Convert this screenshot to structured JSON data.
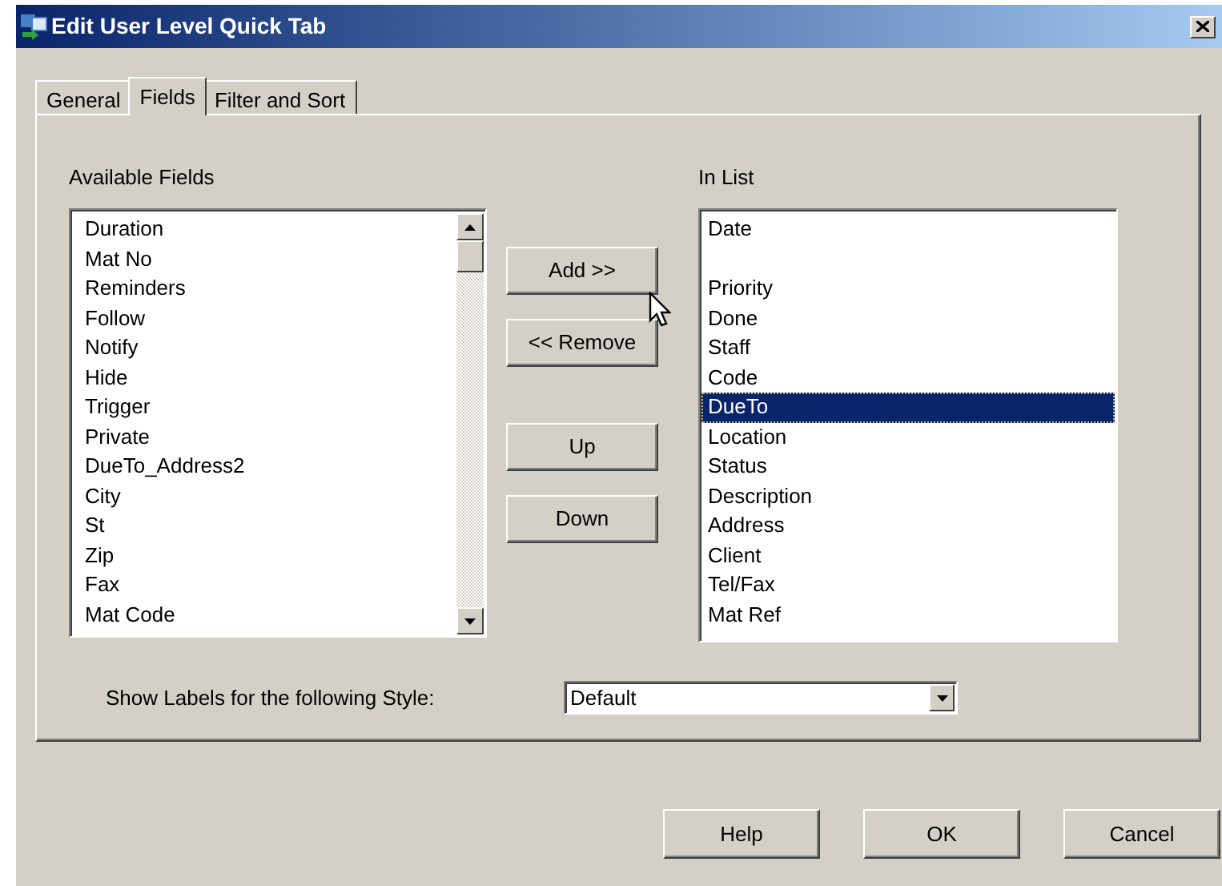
{
  "window": {
    "title": "Edit User Level Quick Tab"
  },
  "tabs": [
    {
      "label": "General",
      "selected": false
    },
    {
      "label": "Fields",
      "selected": true
    },
    {
      "label": "Filter and Sort",
      "selected": false
    }
  ],
  "available_fields": {
    "label": "Available Fields",
    "items": [
      {
        "label": "Duration",
        "selected": false
      },
      {
        "label": "Mat No",
        "selected": false
      },
      {
        "label": "Reminders",
        "selected": false
      },
      {
        "label": "Follow",
        "selected": false
      },
      {
        "label": "Notify",
        "selected": false
      },
      {
        "label": "Hide",
        "selected": false
      },
      {
        "label": "Trigger",
        "selected": false
      },
      {
        "label": "Private",
        "selected": false
      },
      {
        "label": "DueTo_Address2",
        "selected": false
      },
      {
        "label": "City",
        "selected": false
      },
      {
        "label": "St",
        "selected": false
      },
      {
        "label": "Zip",
        "selected": false
      },
      {
        "label": "Fax",
        "selected": false
      },
      {
        "label": "Mat Code",
        "selected": false
      }
    ]
  },
  "move_buttons": [
    "Add >>",
    "<< Remove",
    "Up",
    "Down"
  ],
  "in_list": {
    "label": "In List",
    "items": [
      {
        "kind": "field",
        "label": "Date",
        "selected": false
      },
      {
        "kind": "blank"
      },
      {
        "kind": "field",
        "label": "Priority",
        "selected": false
      },
      {
        "kind": "field",
        "label": "Done",
        "selected": false
      },
      {
        "kind": "field",
        "label": "Staff",
        "selected": false
      },
      {
        "kind": "field",
        "label": "Code",
        "selected": false
      },
      {
        "kind": "field",
        "label": "DueTo",
        "selected": true
      },
      {
        "kind": "field",
        "label": "Location",
        "selected": false
      },
      {
        "kind": "field",
        "label": "Status",
        "selected": false
      },
      {
        "kind": "field",
        "label": "Description",
        "selected": false
      },
      {
        "kind": "field",
        "label": "Address",
        "selected": false
      },
      {
        "kind": "field",
        "label": "Client",
        "selected": false
      },
      {
        "kind": "field",
        "label": "Tel/Fax",
        "selected": false
      },
      {
        "kind": "field",
        "label": "Mat Ref",
        "selected": false
      }
    ]
  },
  "style_option": {
    "label": "Show Labels for the following Style:",
    "value": "Default"
  },
  "buttons": [
    "Help",
    "OK",
    "Cancel"
  ]
}
